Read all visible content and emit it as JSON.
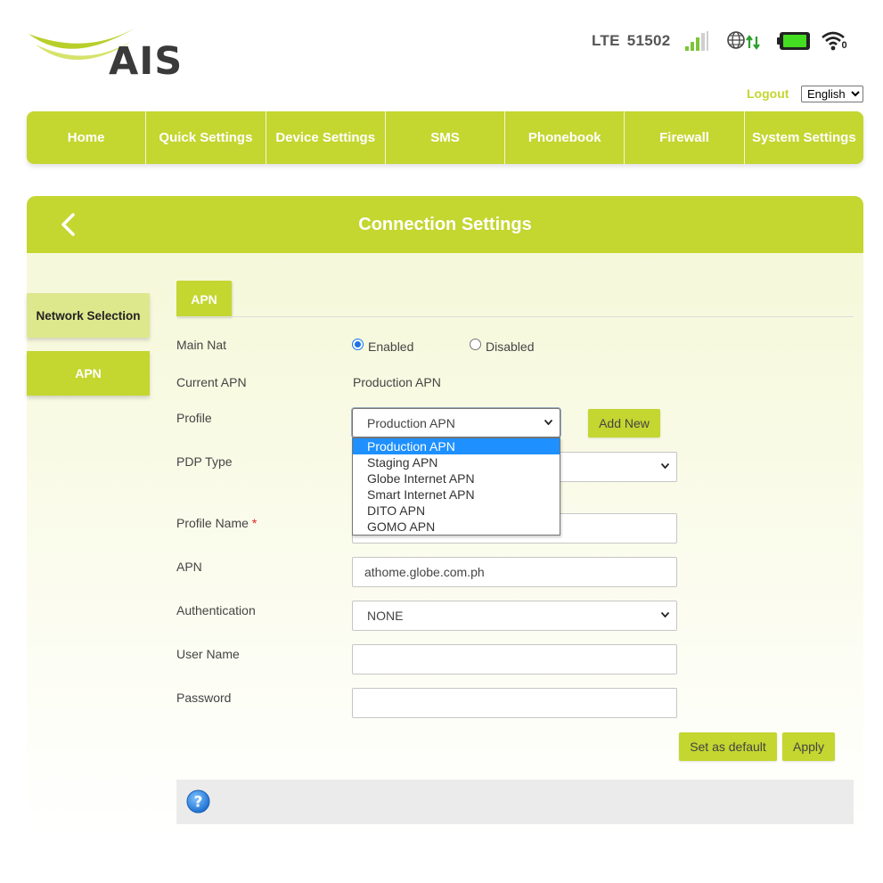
{
  "brand": {
    "logo_text": "AIS"
  },
  "status": {
    "network_type": "LTE",
    "operator_code": "51502",
    "wifi_clients": "0"
  },
  "header": {
    "logout": "Logout",
    "language": "English"
  },
  "nav": [
    "Home",
    "Quick Settings",
    "Device Settings",
    "SMS",
    "Phonebook",
    "Firewall",
    "System Settings"
  ],
  "page": {
    "title": "Connection Settings"
  },
  "sidebar": {
    "network_selection": "Network Selection",
    "apn": "APN"
  },
  "tabs": {
    "apn": "APN"
  },
  "form": {
    "main_nat": {
      "label": "Main Nat",
      "enabled": "Enabled",
      "disabled": "Disabled",
      "value": "Enabled"
    },
    "current_apn": {
      "label": "Current APN",
      "value": "Production APN"
    },
    "profile": {
      "label": "Profile",
      "value": "Production APN",
      "options": [
        "Production APN",
        "Staging APN",
        "Globe Internet APN",
        "Smart Internet APN",
        "DITO APN",
        "GOMO APN"
      ]
    },
    "add_new": "Add New",
    "pdp_type": {
      "label": "PDP Type",
      "value": ""
    },
    "profile_name": {
      "label": "Profile Name",
      "required_mark": "*",
      "value": ""
    },
    "apn": {
      "label": "APN",
      "value": "athome.globe.com.ph"
    },
    "authentication": {
      "label": "Authentication",
      "value": "NONE"
    },
    "user_name": {
      "label": "User Name",
      "value": ""
    },
    "password": {
      "label": "Password",
      "value": ""
    }
  },
  "buttons": {
    "set_default": "Set as default",
    "apply": "Apply"
  },
  "colors": {
    "accent": "#c4d630",
    "accent_light": "#dde88d",
    "selection": "#1e90ff"
  },
  "icons": [
    "signal-icon",
    "globe-icon",
    "data-arrows-icon",
    "battery-icon",
    "wifi-icon",
    "back-chevron-icon",
    "help-icon"
  ]
}
